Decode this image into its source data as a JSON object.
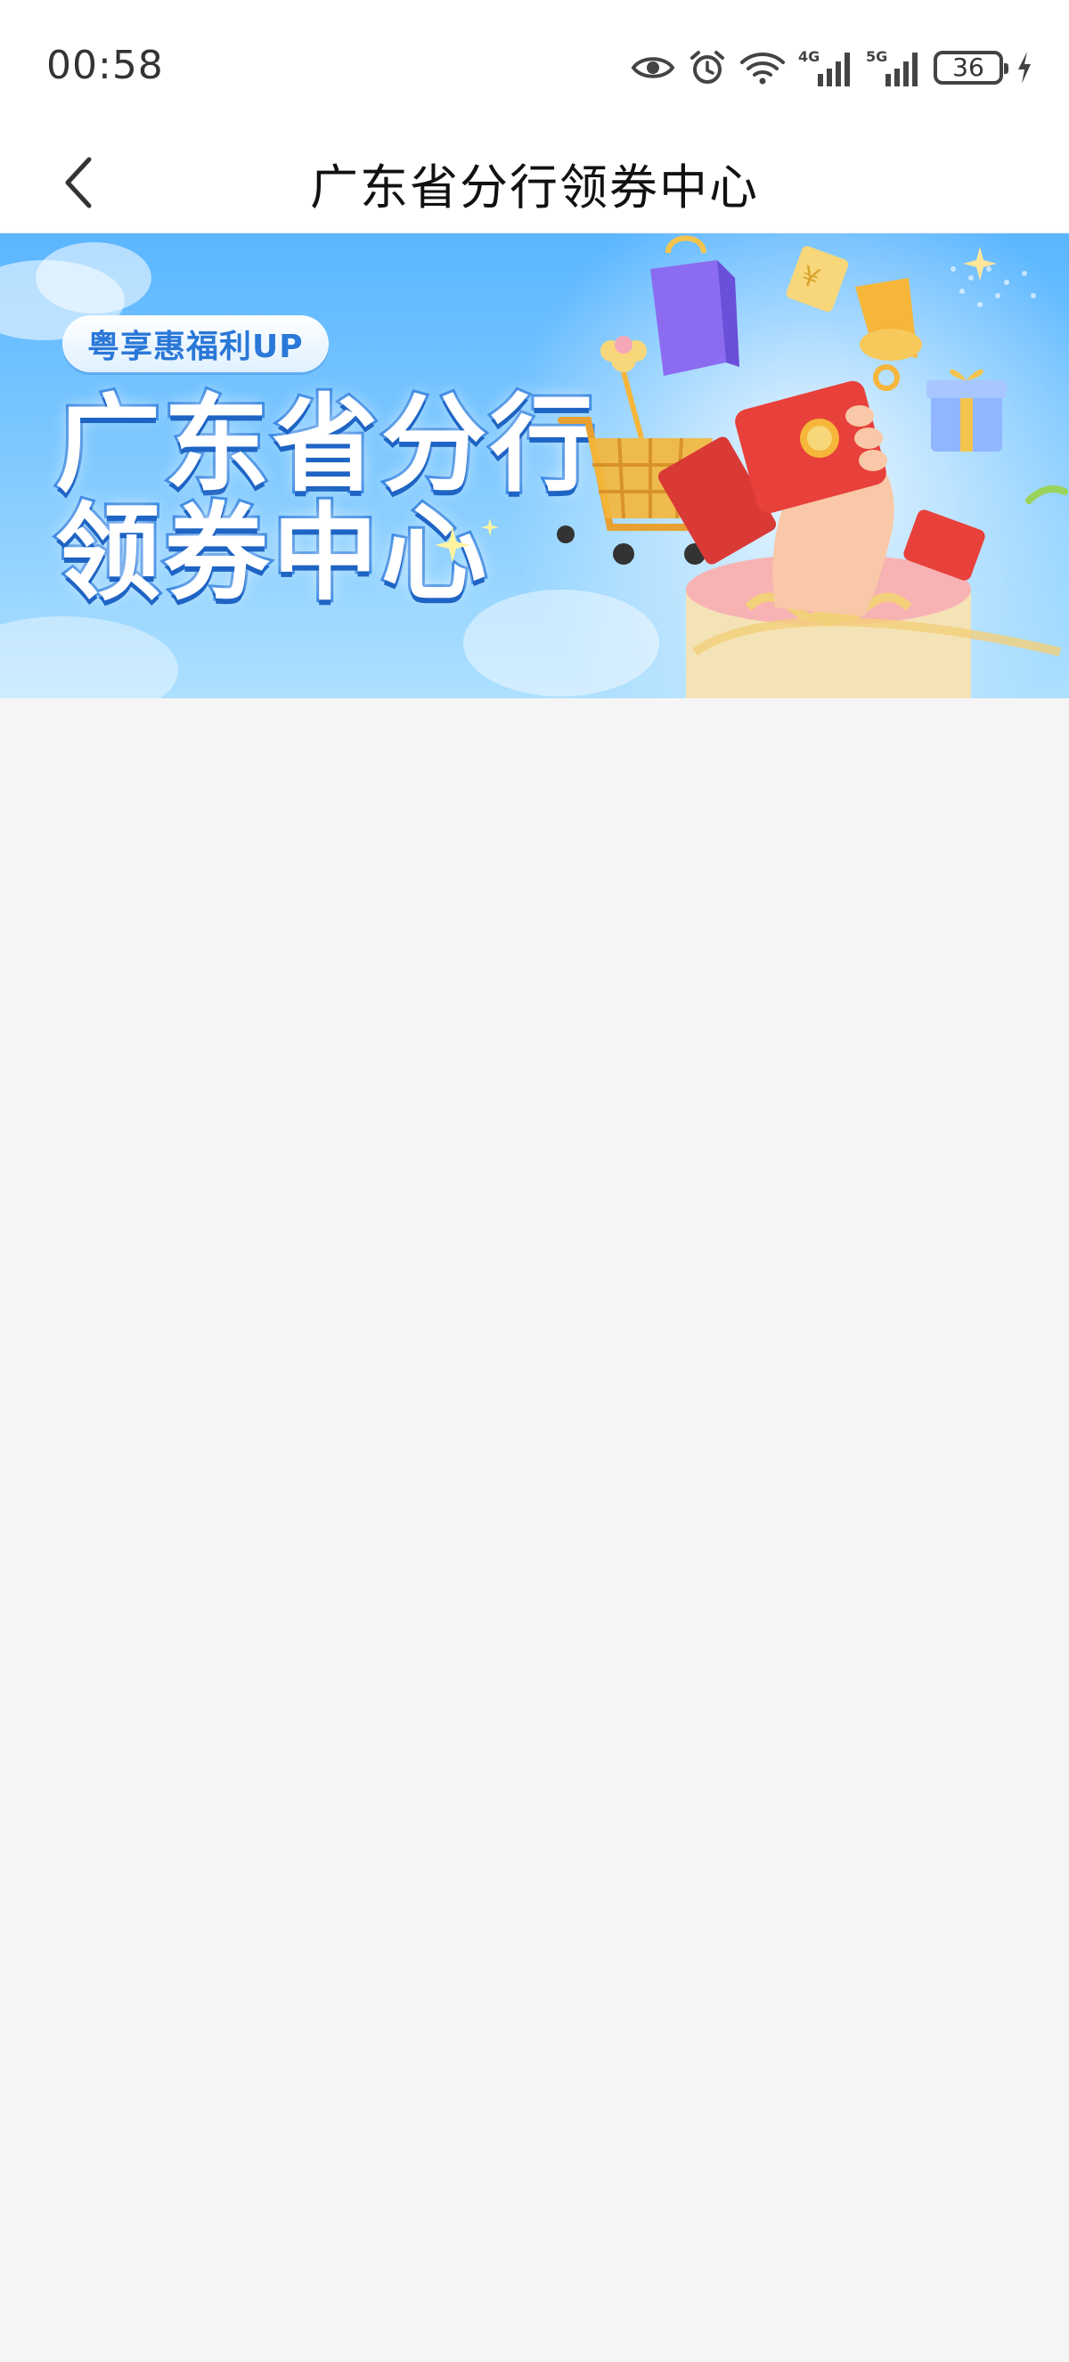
{
  "status_bar": {
    "time": "00:58",
    "battery_level": "36",
    "network_1": "4G",
    "network_2": "5G",
    "icons": [
      "eye-icon",
      "alarm-icon",
      "wifi-icon",
      "signal-4g-icon",
      "signal-5g-icon",
      "battery-icon",
      "charging-icon"
    ]
  },
  "nav": {
    "title": "广东省分行领券中心",
    "back_icon": "chevron-left-icon"
  },
  "banner": {
    "pill_text": "粤享惠福利UP",
    "title_line1": "广东省分行",
    "title_line2": "领券中心",
    "colors": {
      "sky_top": "#5bb6ff",
      "sky_bottom": "#aee0ff",
      "title_stroke": "#2b7fe0",
      "pill_text": "#2a78d8",
      "red_packet": "#e8403a",
      "gold": "#f5b63a",
      "bag_purple": "#8b6cf0"
    }
  },
  "colors": {
    "page_background": "#f5f5f5",
    "header_background": "#ffffff"
  }
}
